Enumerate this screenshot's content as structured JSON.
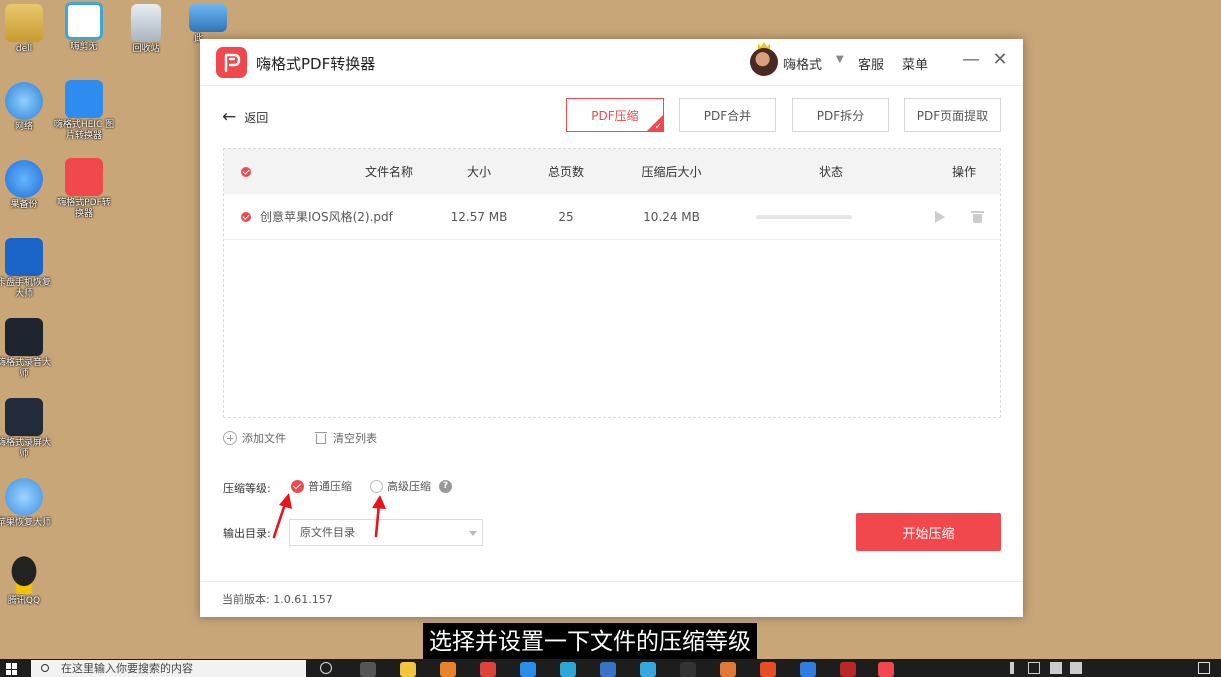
{
  "desktop": {
    "icons": [
      {
        "label": "dell"
      },
      {
        "label": "嗨剪无"
      },
      {
        "label": "回收站"
      },
      {
        "label": "此"
      },
      {
        "label": "网络"
      },
      {
        "label": "嗨格式HEIC 图片转换器"
      },
      {
        "label": "果备份"
      },
      {
        "label": "嗨格式PDF转 换器"
      },
      {
        "label": "卡盘手机恢复 大师"
      },
      {
        "label": "嗨格式录音大 师"
      },
      {
        "label": "嗨格式录屏大 师"
      },
      {
        "label": "苹果恢复大师"
      },
      {
        "label": "腾讯QQ"
      }
    ]
  },
  "window": {
    "title": "嗨格式PDF转换器",
    "username": "嗨格式",
    "service": "客服",
    "menu": "菜单",
    "minimize": "—",
    "close": "✕"
  },
  "toolbar": {
    "back": "返回",
    "tabs": [
      {
        "label": "PDF压缩",
        "active": true
      },
      {
        "label": "PDF合并",
        "active": false
      },
      {
        "label": "PDF拆分",
        "active": false
      },
      {
        "label": "PDF页面提取",
        "active": false
      }
    ]
  },
  "table": {
    "headers": [
      "文件名称",
      "大小",
      "总页数",
      "压缩后大小",
      "状态",
      "操作"
    ],
    "rows": [
      {
        "name": "创意苹果IOS风格(2).pdf",
        "size": "12.57 MB",
        "pages": "25",
        "compressed": "10.24 MB",
        "progress": 0
      }
    ]
  },
  "actions": {
    "add_file": "添加文件",
    "clear_list": "清空列表"
  },
  "compression": {
    "label": "压缩等级:",
    "options": [
      {
        "label": "普通压缩",
        "selected": true
      },
      {
        "label": "高级压缩",
        "selected": false
      }
    ],
    "help": "?"
  },
  "output": {
    "label": "输出目录:",
    "value": "原文件目录"
  },
  "start_button": "开始压缩",
  "footer": {
    "version_label": "当前版本:",
    "version": "1.0.61.157"
  },
  "subtitle": "选择并设置一下文件的压缩等级",
  "taskbar": {
    "search_placeholder": "在这里输入你要搜索的内容"
  },
  "colors": {
    "accent": "#f1484e",
    "desktop": "#c9a678"
  }
}
